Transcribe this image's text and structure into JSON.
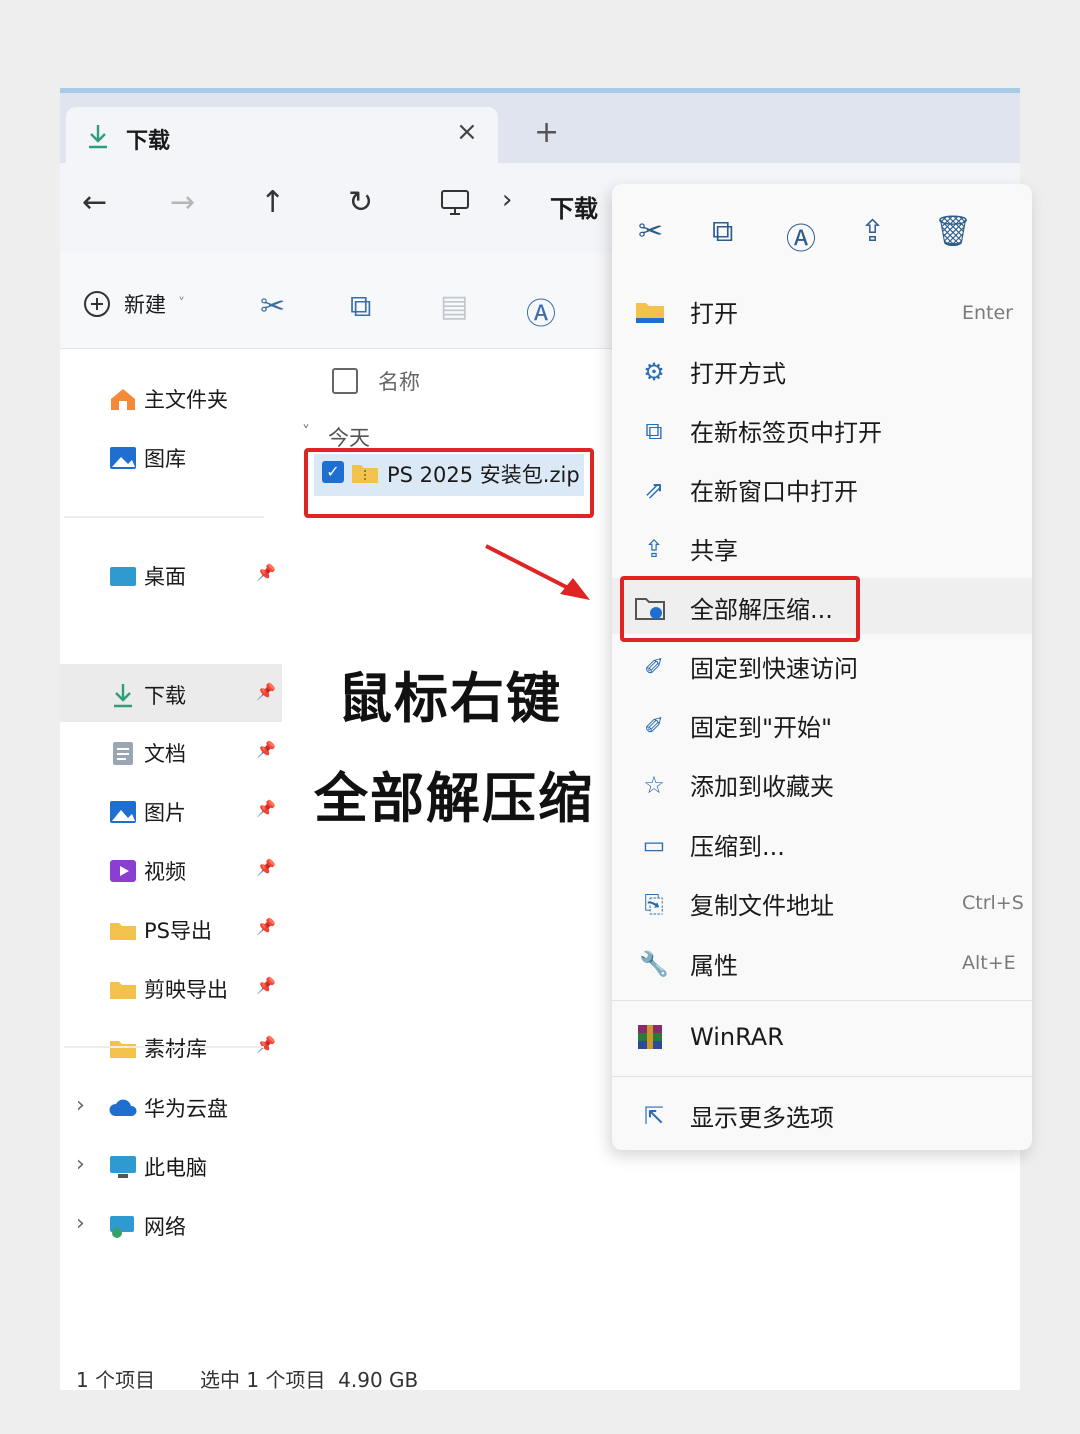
{
  "tab": {
    "title": "下载",
    "close": "×",
    "add": "+"
  },
  "nav": {
    "back": "←",
    "forward": "→",
    "up": "↑",
    "refresh": "↻",
    "sep": "›",
    "breadcrumb": "下载"
  },
  "cmdbar": {
    "new_label": "新建",
    "new_caret": "˅"
  },
  "sidebar": {
    "top_items": [
      {
        "label": "主文件夹",
        "icon": "home-icon"
      },
      {
        "label": "图库",
        "icon": "gallery-icon"
      }
    ],
    "pinned_items": [
      {
        "label": "桌面",
        "icon": "desktop-folder-icon"
      },
      {
        "label": "下载",
        "icon": "download-icon"
      },
      {
        "label": "文档",
        "icon": "documents-icon"
      },
      {
        "label": "图片",
        "icon": "pictures-icon"
      },
      {
        "label": "视频",
        "icon": "videos-icon"
      },
      {
        "label": "PS导出",
        "icon": "folder-icon"
      },
      {
        "label": "剪映导出",
        "icon": "folder-icon"
      },
      {
        "label": "素材库",
        "icon": "folder-icon"
      }
    ],
    "bottom_items": [
      {
        "label": "华为云盘",
        "icon": "cloud-icon"
      },
      {
        "label": "此电脑",
        "icon": "pc-icon"
      },
      {
        "label": "网络",
        "icon": "network-icon"
      }
    ]
  },
  "filelist": {
    "column_name": "名称",
    "group_label": "今天",
    "file_name": "PS 2025 安装包.zip"
  },
  "annotation": {
    "line1": "鼠标右键",
    "line2": "全部解压缩"
  },
  "context_menu": {
    "items": [
      {
        "label": "打开",
        "shortcut": "Enter",
        "icon": "folder-open-icon"
      },
      {
        "label": "打开方式",
        "shortcut": "",
        "icon": "open-with-icon"
      },
      {
        "label": "在新标签页中打开",
        "shortcut": "",
        "icon": "new-tab-icon"
      },
      {
        "label": "在新窗口中打开",
        "shortcut": "",
        "icon": "new-window-icon"
      },
      {
        "label": "共享",
        "shortcut": "",
        "icon": "share-icon"
      },
      {
        "label": "全部解压缩...",
        "shortcut": "",
        "icon": "extract-all-icon"
      },
      {
        "label": "固定到快速访问",
        "shortcut": "",
        "icon": "pin-icon"
      },
      {
        "label": "固定到\"开始\"",
        "shortcut": "",
        "icon": "pin-start-icon"
      },
      {
        "label": "添加到收藏夹",
        "shortcut": "",
        "icon": "star-icon"
      },
      {
        "label": "压缩到...",
        "shortcut": "",
        "icon": "compress-icon"
      },
      {
        "label": "复制文件地址",
        "shortcut": "Ctrl+S",
        "icon": "copy-path-icon"
      },
      {
        "label": "属性",
        "shortcut": "Alt+E",
        "icon": "properties-icon"
      },
      {
        "label": "WinRAR",
        "shortcut": "",
        "icon": "winrar-icon"
      },
      {
        "label": "显示更多选项",
        "shortcut": "",
        "icon": "more-options-icon"
      }
    ]
  },
  "status": {
    "count": "1 个项目",
    "selection": "选中 1 个项目  4.90 GB"
  },
  "colors": {
    "accent": "#1f6fd1",
    "highlight_box": "#e02424",
    "folder": "#f3c24d",
    "arrow": "#e02424"
  }
}
